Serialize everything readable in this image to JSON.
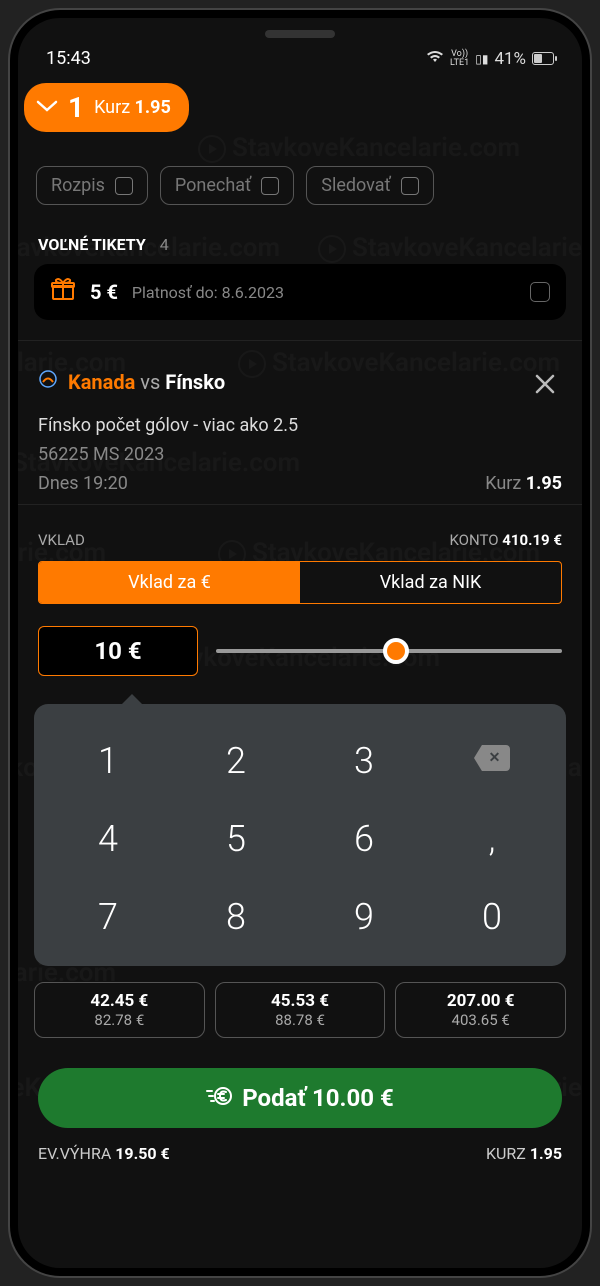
{
  "status": {
    "time": "15:43",
    "lte": "Vo))\nLTE1",
    "battery_pct": "41%",
    "signal": "▮▯"
  },
  "pill": {
    "count": "1",
    "kurz_label": "Kurz",
    "kurz_value": "1.95"
  },
  "chips": {
    "rozpis": "Rozpis",
    "ponechat": "Ponechať",
    "sledovat": "Sledovať"
  },
  "tickets": {
    "label": "VOĽNÉ TIKETY",
    "count": "4",
    "gift_value": "5 €",
    "expiry": "Platnosť do: 8.6.2023"
  },
  "bet": {
    "team1": "Kanada",
    "vs": "vs",
    "team2": "Fínsko",
    "market": "Fínsko počet gólov - viac ako 2.5",
    "event_code": "56225  MS 2023",
    "time": "Dnes 19:20",
    "kurz_label": "Kurz",
    "kurz_value": "1.95"
  },
  "stake": {
    "vklad_label": "VKLAD",
    "konto_label": "KONTO",
    "konto_value": "410.19 €",
    "tab_eur": "Vklad za €",
    "tab_nik": "Vklad za NIK",
    "value": "10 €"
  },
  "keypad": {
    "r1": [
      "1",
      "2",
      "3"
    ],
    "r2": [
      "4",
      "5",
      "6",
      ","
    ],
    "r3": [
      "7",
      "8",
      "9",
      "0"
    ]
  },
  "quicks": [
    {
      "a": "42.45 €",
      "b": "82.78 €"
    },
    {
      "a": "45.53 €",
      "b": "88.78 €"
    },
    {
      "a": "207.00 €",
      "b": "403.65 €"
    }
  ],
  "submit": {
    "label": "Podať 10.00 €"
  },
  "footer": {
    "win_label": "EV.VÝHRA",
    "win_value": "19.50 €",
    "kurz_label": "KURZ",
    "kurz_value": "1.95"
  },
  "watermark": "StavkoveKancelarie.com"
}
